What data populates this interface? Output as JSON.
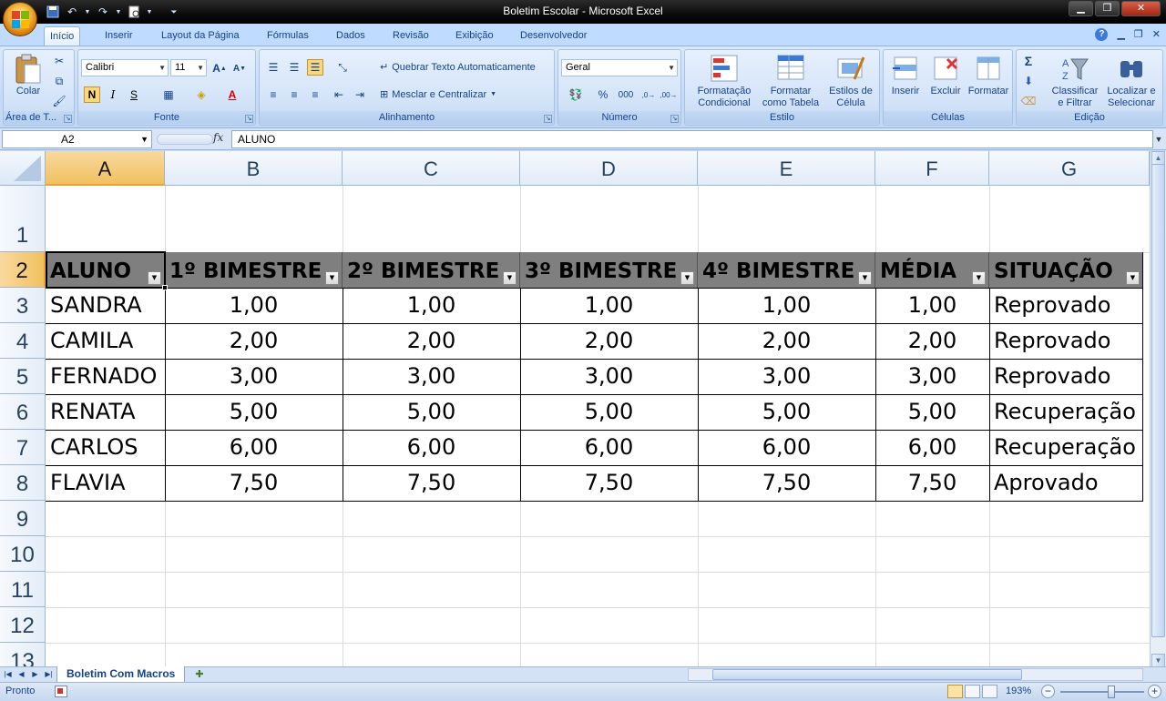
{
  "window": {
    "title": "Boletim Escolar - Microsoft Excel",
    "controls": {
      "minimize": "▁",
      "restore": "❐",
      "close": "✕"
    }
  },
  "ribbon_tabs": [
    {
      "label": "Início",
      "active": true
    },
    {
      "label": "Inserir"
    },
    {
      "label": "Layout da Página"
    },
    {
      "label": "Fórmulas"
    },
    {
      "label": "Dados"
    },
    {
      "label": "Revisão"
    },
    {
      "label": "Exibição"
    },
    {
      "label": "Desenvolvedor"
    }
  ],
  "ribbon": {
    "clipboard": {
      "paste": "Colar",
      "label": "Área de T..."
    },
    "font": {
      "name": "Calibri",
      "size": "11",
      "bold": "N",
      "italic": "I",
      "underline": "S",
      "label": "Fonte"
    },
    "alignment": {
      "wrap": "Quebrar Texto Automaticamente",
      "merge": "Mesclar e Centralizar",
      "label": "Alinhamento"
    },
    "number": {
      "format": "Geral",
      "percent": "%",
      "thousands": "000",
      "label": "Número"
    },
    "styles": {
      "conditional_1": "Formatação",
      "conditional_2": "Condicional",
      "table_1": "Formatar",
      "table_2": "como Tabela",
      "cell_1": "Estilos de",
      "cell_2": "Célula",
      "label": "Estilo"
    },
    "cells": {
      "insert": "Inserir",
      "delete": "Excluir",
      "format": "Formatar",
      "label": "Células"
    },
    "editing": {
      "sort_1": "Classificar",
      "sort_2": "e Filtrar",
      "find_1": "Localizar e",
      "find_2": "Selecionar",
      "label": "Edição"
    }
  },
  "formula_bar": {
    "name_box": "A2",
    "fx": "fx",
    "formula": "ALUNO"
  },
  "columns": [
    "A",
    "B",
    "C",
    "D",
    "E",
    "F",
    "G"
  ],
  "rows": [
    "1",
    "2",
    "3",
    "4",
    "5",
    "6",
    "7",
    "8",
    "9",
    "10",
    "11",
    "12",
    "13"
  ],
  "table": {
    "headers": [
      "ALUNO",
      "1º BIMESTRE",
      "2º BIMESTRE",
      "3º BIMESTRE",
      "4º BIMESTRE",
      "MÉDIA",
      "SITUAÇÃO"
    ],
    "rows": [
      [
        "SANDRA",
        "1,00",
        "1,00",
        "1,00",
        "1,00",
        "1,00",
        "Reprovado"
      ],
      [
        "CAMILA",
        "2,00",
        "2,00",
        "2,00",
        "2,00",
        "2,00",
        "Reprovado"
      ],
      [
        "FERNADO",
        "3,00",
        "3,00",
        "3,00",
        "3,00",
        "3,00",
        "Reprovado"
      ],
      [
        "RENATA",
        "5,00",
        "5,00",
        "5,00",
        "5,00",
        "5,00",
        "Recuperação"
      ],
      [
        "CARLOS",
        "6,00",
        "6,00",
        "6,00",
        "6,00",
        "6,00",
        "Recuperação"
      ],
      [
        "FLAVIA",
        "7,50",
        "7,50",
        "7,50",
        "7,50",
        "7,50",
        "Aprovado"
      ]
    ]
  },
  "sheet_tab": "Boletim Com Macros",
  "status": {
    "text": "Pronto",
    "zoom": "193%"
  },
  "colors": {
    "header_fill": "#7f7f7f",
    "selection": "#f1c15f",
    "ribbon": "#c8daf3"
  }
}
